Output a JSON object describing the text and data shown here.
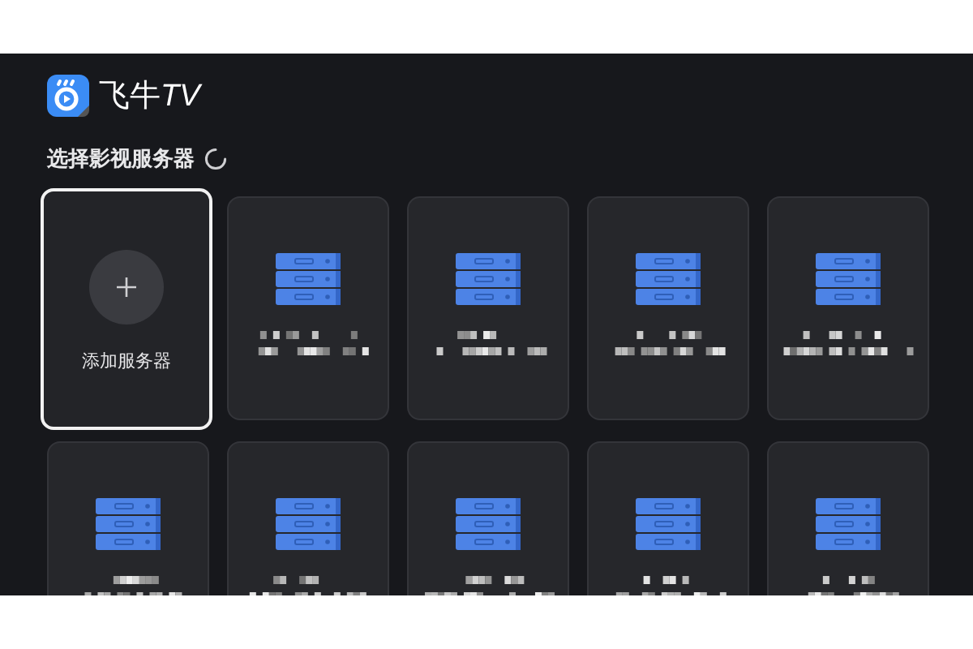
{
  "app": {
    "name": "飞牛",
    "suffix": "TV"
  },
  "heading": {
    "text": "选择影视服务器",
    "loading": true
  },
  "cards": [
    {
      "kind": "add",
      "label": "添加服务器",
      "selected": true
    },
    {
      "kind": "server",
      "selected": false
    },
    {
      "kind": "server",
      "selected": false
    },
    {
      "kind": "server",
      "selected": false
    },
    {
      "kind": "server",
      "selected": false
    },
    {
      "kind": "server",
      "selected": false
    },
    {
      "kind": "server",
      "selected": false
    },
    {
      "kind": "server",
      "selected": false
    },
    {
      "kind": "server",
      "selected": false
    },
    {
      "kind": "server",
      "selected": false
    }
  ]
}
